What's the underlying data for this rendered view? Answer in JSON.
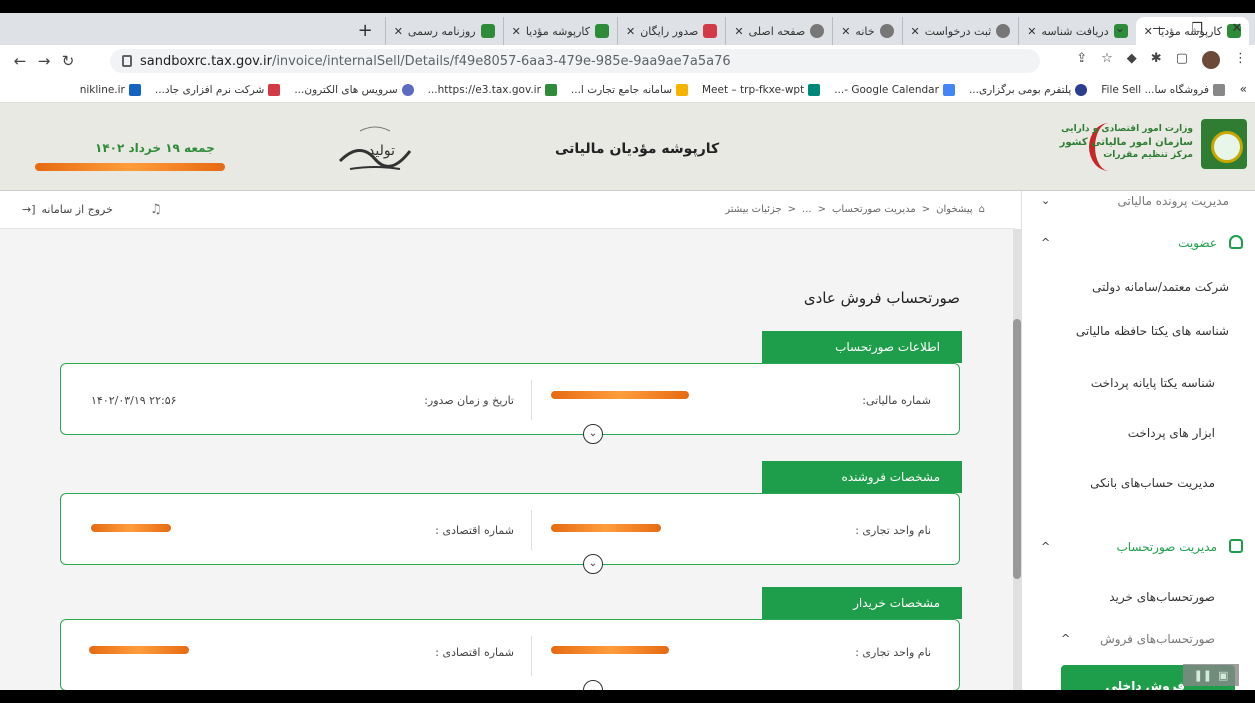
{
  "browser": {
    "tabs": [
      {
        "label": "کارپوشه مؤدیا",
        "active": true
      },
      {
        "label": "دریافت شناسه"
      },
      {
        "label": "ثبت درخواست"
      },
      {
        "label": "خانه"
      },
      {
        "label": "صفحه اصلی"
      },
      {
        "label": "صدور رایگان"
      },
      {
        "label": "کارپوشه مؤدیا"
      },
      {
        "label": "روزنامه رسمی"
      }
    ],
    "url_host": "sandboxrc.tax.gov.ir",
    "url_path": "/invoice/internalSell/Details/f49e8057-6aa3-479e-985e-9aa9ae7a5a76",
    "bookmarks": [
      "فروشگاه سا... File Sell",
      "پلتفرم بومی برگزاری...",
      "Google Calendar -...",
      "Meet – trp-fkxe-wpt",
      "سامانه جامع تجارت ا...",
      "https://e3.tax.gov.ir...",
      "سرویس های الکترون...",
      "شرکت نرم افزاری جاد...",
      "nikline.ir"
    ]
  },
  "header": {
    "ministry_line1": "وزارت امور اقتصادی و دارایی",
    "ministry_line2": "سازمان امور مالیاتی کشور",
    "ministry_line3": "مرکز تنظیم مقررات",
    "title": "کارپوشه مؤدیان مالیاتی",
    "calligraphy": "تولید",
    "date": "جمعه ۱۹ خرداد ۱۴۰۲"
  },
  "topbar": {
    "logout": "خروج از سامانه",
    "breadcrumb": [
      "پیشخوان",
      "مدیریت صورتحساب",
      "...",
      "جزئیات بیشتر"
    ]
  },
  "page": {
    "title": "صورتحساب فروش عادی",
    "sections": [
      {
        "label": "اطلاعات صورتحساب",
        "field1": "شماره مالیاتی:",
        "field2": "تاریخ و زمان صدور:",
        "value2": "۱۴۰۲/۰۳/۱۹   ۲۲:۵۶"
      },
      {
        "label": "مشخصات فروشنده",
        "field1": "نام واحد تجاری :",
        "field2": "شماره اقتصادی :"
      },
      {
        "label": "مشخصات خریدار",
        "field1": "نام واحد تجاری :",
        "field2": "شماره اقتصادی :"
      }
    ]
  },
  "sidebar": {
    "top_item": "مدیریت پرونده مالیاتی",
    "membership": "عضویت",
    "items": [
      "شرکت معتمد/سامانه دولتی",
      "شناسه های یکتا حافظه مالیاتی",
      "شناسه یکتا پایانه پرداخت",
      "ابزار های پرداخت",
      "مدیریت حساب‌های بانکی"
    ],
    "invoice_mgmt": "مدیریت صورتحساب",
    "purchase": "صورتحساب‌های خرید",
    "sales": "صورتحساب‌های فروش",
    "active": "فروش داخلی"
  },
  "colors": {
    "accent": "#1e9e4a",
    "redaction": "#f07a1a"
  }
}
